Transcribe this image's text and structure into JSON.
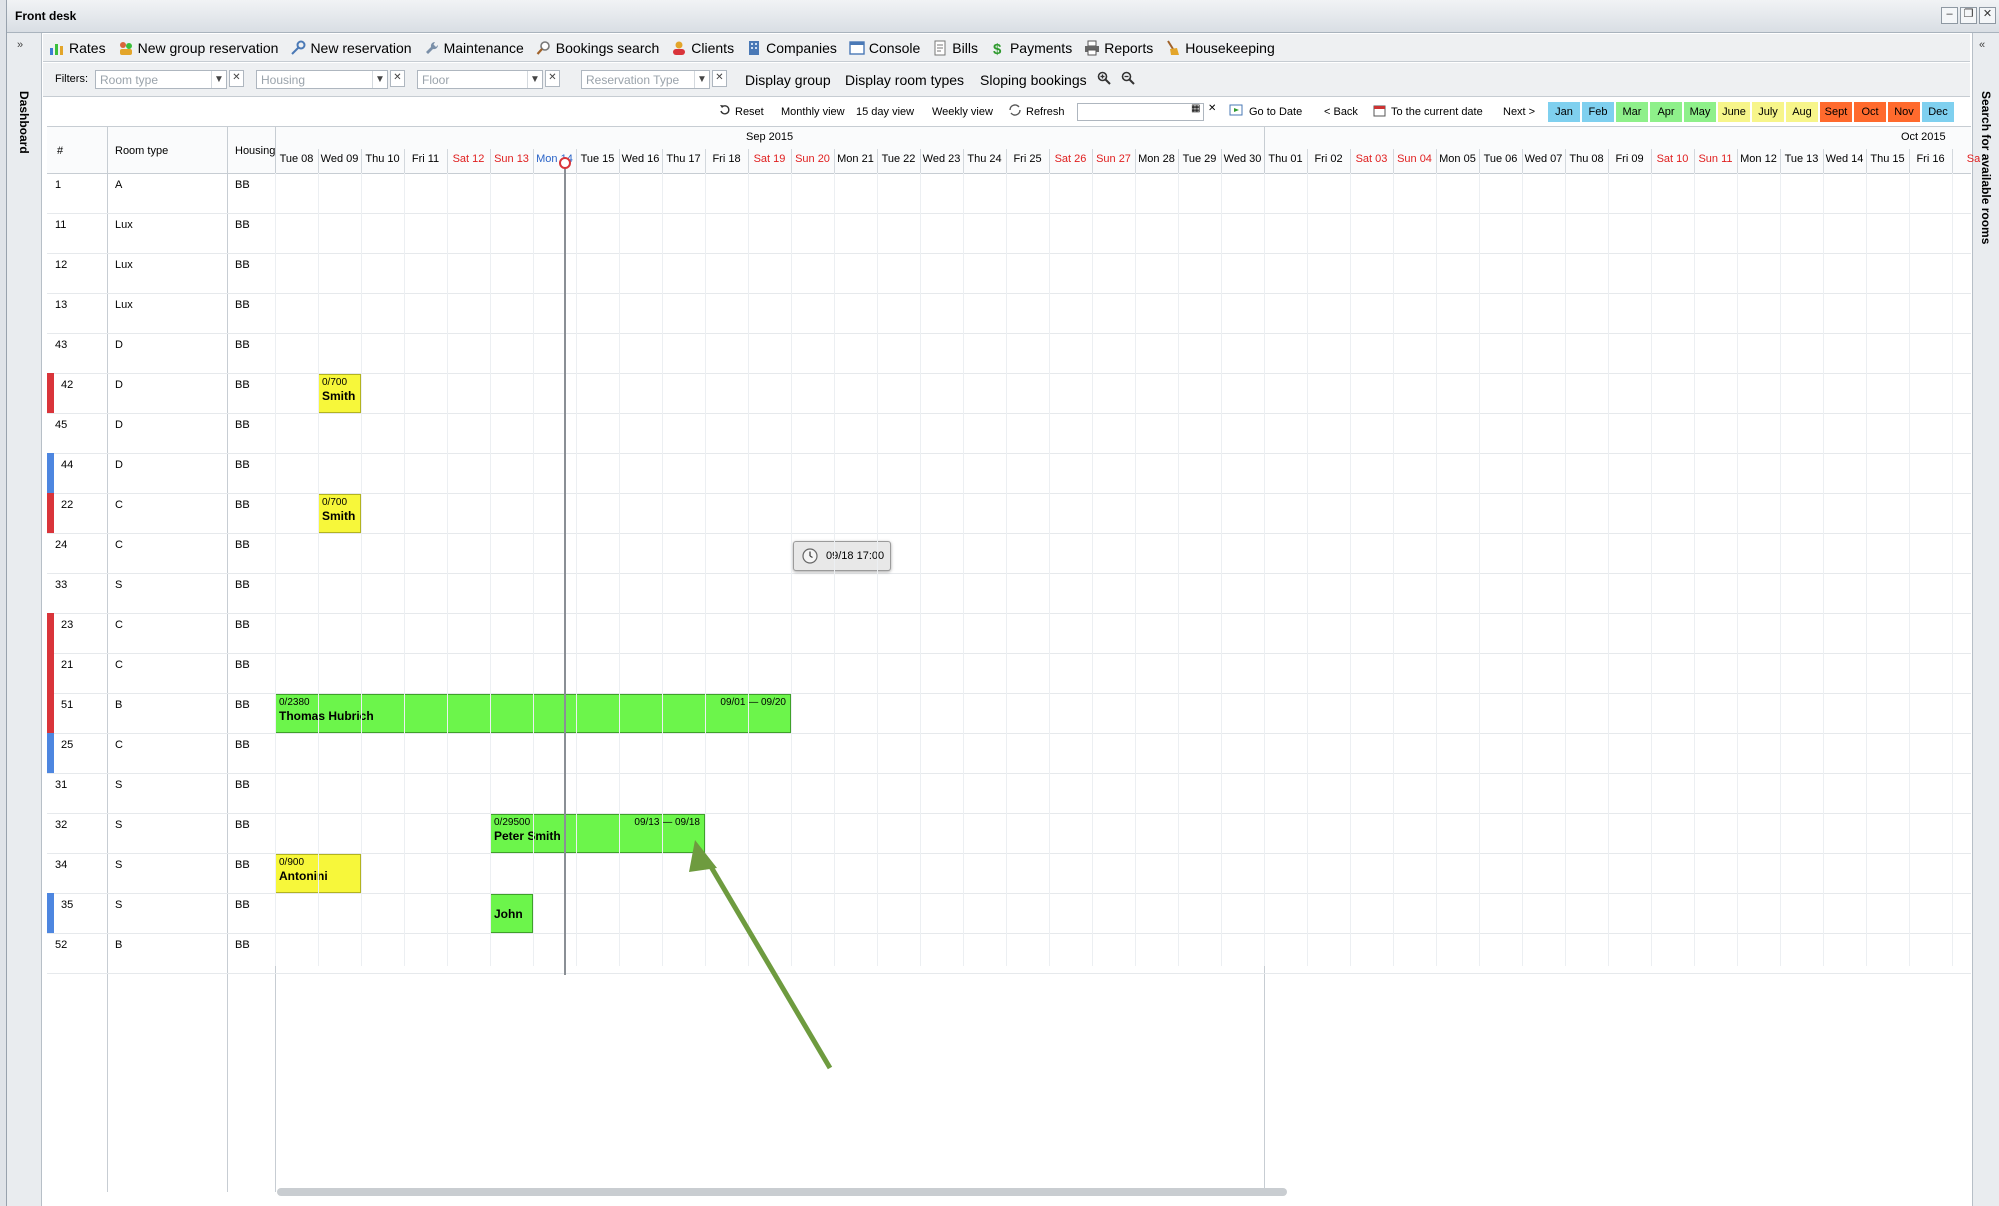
{
  "window": {
    "title": "Front desk"
  },
  "side": {
    "left_label": "Dashboard",
    "right_label": "Search for available rooms"
  },
  "menu": [
    {
      "label": "Rates",
      "icon": "chart-icon"
    },
    {
      "label": "New group reservation",
      "icon": "group-icon"
    },
    {
      "label": "New reservation",
      "icon": "key-icon"
    },
    {
      "label": "Maintenance",
      "icon": "wrench-icon"
    },
    {
      "label": "Bookings search",
      "icon": "magnifier-icon"
    },
    {
      "label": "Clients",
      "icon": "clients-icon"
    },
    {
      "label": "Companies",
      "icon": "building-icon"
    },
    {
      "label": "Console",
      "icon": "console-icon"
    },
    {
      "label": "Bills",
      "icon": "bill-icon"
    },
    {
      "label": "Payments",
      "icon": "dollar-icon"
    },
    {
      "label": "Reports",
      "icon": "printer-icon"
    },
    {
      "label": "Housekeeping",
      "icon": "broom-icon"
    }
  ],
  "filters": {
    "label": "Filters:",
    "room_type_placeholder": "Room type",
    "housing_placeholder": "Housing",
    "floor_placeholder": "Floor",
    "reservation_type_placeholder": "Reservation Type",
    "display_group": "Display group",
    "display_room_types": "Display room types",
    "sloping_bookings": "Sloping bookings"
  },
  "nav": {
    "reset": "Reset",
    "monthly": "Monthly view",
    "fifteen": "15 day view",
    "weekly": "Weekly view",
    "refresh": "Refresh",
    "goto": "Go to Date",
    "back": "< Back",
    "current": "To the current date",
    "next": "Next >"
  },
  "months": [
    {
      "label": "Jan",
      "color": "#7fd0ef"
    },
    {
      "label": "Feb",
      "color": "#7fd0ef"
    },
    {
      "label": "Mar",
      "color": "#8ef08a"
    },
    {
      "label": "Apr",
      "color": "#8ef08a"
    },
    {
      "label": "May",
      "color": "#8ef08a"
    },
    {
      "label": "June",
      "color": "#f7f58a"
    },
    {
      "label": "July",
      "color": "#f7f58a"
    },
    {
      "label": "Aug",
      "color": "#f7f58a"
    },
    {
      "label": "Sept",
      "color": "#ff6a2d"
    },
    {
      "label": "Oct",
      "color": "#ff6a2d"
    },
    {
      "label": "Nov",
      "color": "#ff6a2d"
    },
    {
      "label": "Dec",
      "color": "#7fd0ef"
    }
  ],
  "grid": {
    "col_num": "#",
    "col_room_type": "Room type",
    "col_housing": "Housing",
    "month_sep": "Sep 2015",
    "month_oct": "Oct 2015",
    "days": [
      {
        "label": "Tue 08",
        "weekend": false
      },
      {
        "label": "Wed 09",
        "weekend": false
      },
      {
        "label": "Thu 10",
        "weekend": false
      },
      {
        "label": "Fri 11",
        "weekend": false
      },
      {
        "label": "Sat 12",
        "weekend": true
      },
      {
        "label": "Sun 13",
        "weekend": true
      },
      {
        "label": "Mon 14",
        "weekend": false
      },
      {
        "label": "Tue 15",
        "weekend": false
      },
      {
        "label": "Wed 16",
        "weekend": false
      },
      {
        "label": "Thu 17",
        "weekend": false
      },
      {
        "label": "Fri 18",
        "weekend": false
      },
      {
        "label": "Sat 19",
        "weekend": true
      },
      {
        "label": "Sun 20",
        "weekend": true
      },
      {
        "label": "Mon 21",
        "weekend": false
      },
      {
        "label": "Tue 22",
        "weekend": false
      },
      {
        "label": "Wed 23",
        "weekend": false
      },
      {
        "label": "Thu 24",
        "weekend": false
      },
      {
        "label": "Fri 25",
        "weekend": false
      },
      {
        "label": "Sat 26",
        "weekend": true
      },
      {
        "label": "Sun 27",
        "weekend": true
      },
      {
        "label": "Mon 28",
        "weekend": false
      },
      {
        "label": "Tue 29",
        "weekend": false
      },
      {
        "label": "Wed 30",
        "weekend": false
      },
      {
        "label": "Thu 01",
        "weekend": false
      },
      {
        "label": "Fri 02",
        "weekend": false
      },
      {
        "label": "Sat 03",
        "weekend": true
      },
      {
        "label": "Sun 04",
        "weekend": true
      },
      {
        "label": "Mon 05",
        "weekend": false
      },
      {
        "label": "Tue 06",
        "weekend": false
      },
      {
        "label": "Wed 07",
        "weekend": false
      },
      {
        "label": "Thu 08",
        "weekend": false
      },
      {
        "label": "Fri 09",
        "weekend": false
      },
      {
        "label": "Sat 10",
        "weekend": true
      },
      {
        "label": "Sun 11",
        "weekend": true
      },
      {
        "label": "Mon 12",
        "weekend": false
      },
      {
        "label": "Tue 13",
        "weekend": false
      },
      {
        "label": "Wed 14",
        "weekend": false
      },
      {
        "label": "Thu 15",
        "weekend": false
      },
      {
        "label": "Fri 16",
        "weekend": false
      },
      {
        "label": "Sa",
        "weekend": true
      }
    ],
    "rooms": [
      {
        "num": "1",
        "type": "A",
        "housing": "BB",
        "mark": ""
      },
      {
        "num": "11",
        "type": "Lux",
        "housing": "BB",
        "mark": ""
      },
      {
        "num": "12",
        "type": "Lux",
        "housing": "BB",
        "mark": ""
      },
      {
        "num": "13",
        "type": "Lux",
        "housing": "BB",
        "mark": ""
      },
      {
        "num": "43",
        "type": "D",
        "housing": "BB",
        "mark": ""
      },
      {
        "num": "42",
        "type": "D",
        "housing": "BB",
        "mark": "#d9343a"
      },
      {
        "num": "45",
        "type": "D",
        "housing": "BB",
        "mark": ""
      },
      {
        "num": "44",
        "type": "D",
        "housing": "BB",
        "mark": "#4d86e0"
      },
      {
        "num": "22",
        "type": "C",
        "housing": "BB",
        "mark": "#d9343a"
      },
      {
        "num": "24",
        "type": "C",
        "housing": "BB",
        "mark": ""
      },
      {
        "num": "33",
        "type": "S",
        "housing": "BB",
        "mark": ""
      },
      {
        "num": "23",
        "type": "C",
        "housing": "BB",
        "mark": "#d9343a"
      },
      {
        "num": "21",
        "type": "C",
        "housing": "BB",
        "mark": "#d9343a"
      },
      {
        "num": "51",
        "type": "B",
        "housing": "BB",
        "mark": "#d9343a"
      },
      {
        "num": "25",
        "type": "C",
        "housing": "BB",
        "mark": "#4d86e0"
      },
      {
        "num": "31",
        "type": "S",
        "housing": "BB",
        "mark": ""
      },
      {
        "num": "32",
        "type": "S",
        "housing": "BB",
        "mark": ""
      },
      {
        "num": "34",
        "type": "S",
        "housing": "BB",
        "mark": ""
      },
      {
        "num": "35",
        "type": "S",
        "housing": "BB",
        "mark": "#4d86e0"
      },
      {
        "num": "52",
        "type": "B",
        "housing": "BB",
        "mark": ""
      }
    ],
    "bookings": [
      {
        "row": 5,
        "start": 1,
        "len": 1,
        "amount": "0/700",
        "name": "Smith",
        "dates": "",
        "color": "#f7f73a"
      },
      {
        "row": 8,
        "start": 1,
        "len": 1,
        "amount": "0/700",
        "name": "Smith",
        "dates": "",
        "color": "#f7f73a"
      },
      {
        "row": 13,
        "start": 0,
        "len": 12,
        "amount": "0/2380",
        "name": "Thomas Hubrich",
        "dates": "09/01 — 09/20",
        "color": "#6cf54b"
      },
      {
        "row": 16,
        "start": 5,
        "len": 5,
        "amount": "0/29500",
        "name": "Peter Smith",
        "dates": "09/13 — 09/18",
        "color": "#6cf54b"
      },
      {
        "row": 17,
        "start": 0,
        "len": 2,
        "amount": "0/900",
        "name": "Antonini",
        "dates": "",
        "color": "#f7f73a"
      },
      {
        "row": 18,
        "start": 5,
        "len": 1,
        "amount": "",
        "name": "John",
        "dates": "",
        "color": "#6cf54b"
      }
    ],
    "tooltip": "09/18 17:00"
  }
}
